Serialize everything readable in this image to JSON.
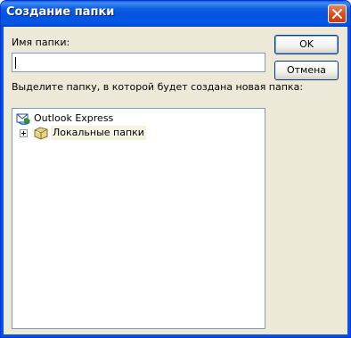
{
  "window": {
    "title": "Создание папки"
  },
  "form": {
    "folder_name_label": "Имя папки:",
    "folder_name_value": "",
    "select_label": "Выделите папку, в которой будет создана новая папка:"
  },
  "buttons": {
    "ok": "OK",
    "cancel": "Отмена"
  },
  "tree": {
    "root": {
      "label": "Outlook Express",
      "icon": "outlook-express-icon"
    },
    "children": [
      {
        "label": "Локальные папки",
        "icon": "local-folders-icon",
        "expander": "plus"
      }
    ]
  },
  "colors": {
    "titlebar": "#0353df",
    "dialog_bg": "#ece9d8",
    "close_button": "#d9501f",
    "field_border": "#7f9db9"
  }
}
